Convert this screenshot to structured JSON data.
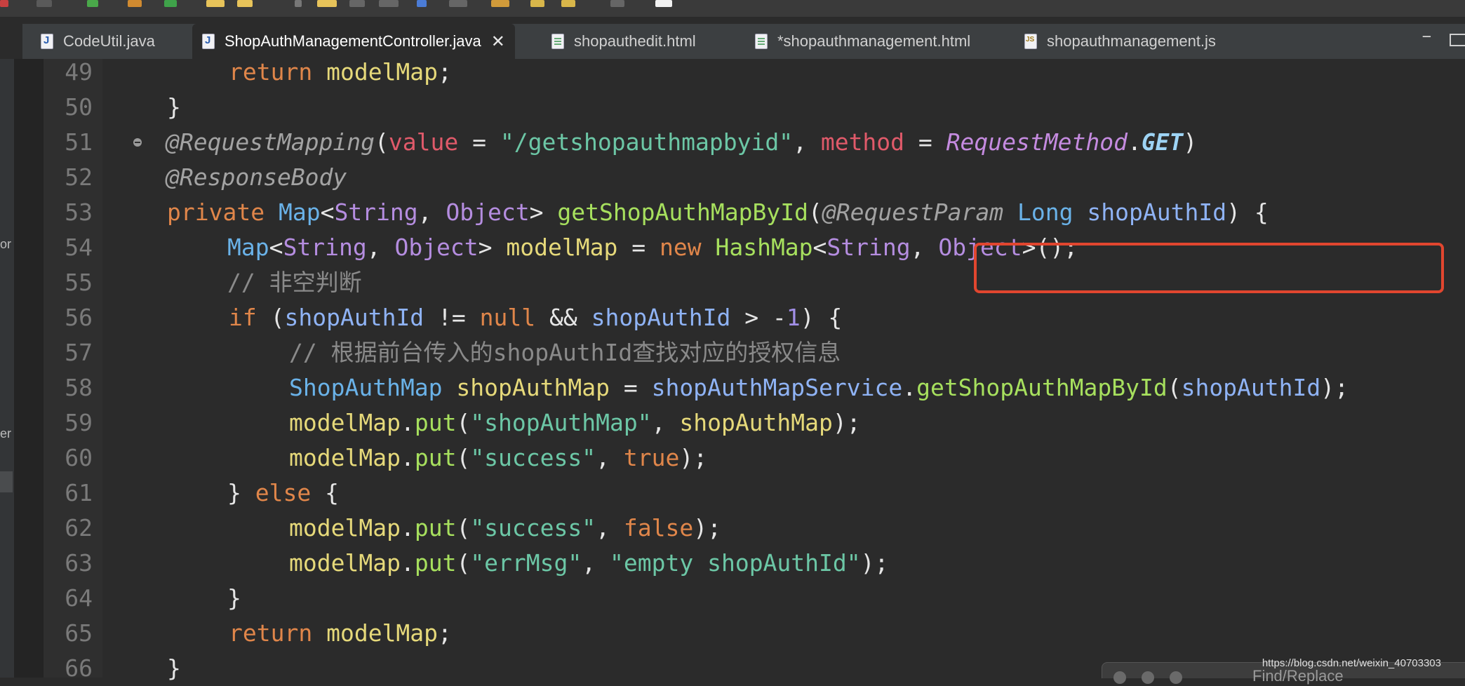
{
  "tabs": [
    {
      "label": "CodeUtil.java",
      "icon": "java-file-icon",
      "active": false
    },
    {
      "label": "ShopAuthManagementController.java",
      "icon": "java-file-icon",
      "active": true
    },
    {
      "label": "shopauthedit.html",
      "icon": "html-file-icon",
      "active": false
    },
    {
      "label": "*shopauthmanagement.html",
      "icon": "html-file-icon",
      "active": false
    },
    {
      "label": "shopauthmanagement.js",
      "icon": "js-file-icon",
      "active": false
    }
  ],
  "close_glyph": "✕",
  "window_controls": {
    "minimize": "−"
  },
  "left_panel": {
    "fragment_1": "or",
    "fragment_2": "er"
  },
  "line_numbers": [
    "49",
    "50",
    "51",
    "52",
    "53",
    "54",
    "55",
    "56",
    "57",
    "58",
    "59",
    "60",
    "61",
    "62",
    "63",
    "64",
    "65",
    "66"
  ],
  "code": {
    "l49_kw": "return",
    "l49_var": "modelMap",
    "l49_end": ";",
    "l50": "}",
    "l51_ann": "@RequestMapping",
    "l51_p1": "(",
    "l51_key1": "value",
    "l51_eq1": " = ",
    "l51_str": "\"/getshopauthmapbyid\"",
    "l51_c": ", ",
    "l51_key2": "method",
    "l51_eq2": " = ",
    "l51_enum": "RequestMethod",
    "l51_dot": ".",
    "l51_get": "GET",
    "l51_p2": ")",
    "l52_ann": "@ResponseBody",
    "l53_kw": "private",
    "l53_ty": "Map",
    "l53_lt": "<",
    "l53_g1": "String",
    "l53_cm": ", ",
    "l53_g2": "Object",
    "l53_gt": "> ",
    "l53_fn": "getShopAuthMapById",
    "l53_p1": "(",
    "l53_ann": "@RequestParam",
    "l53_ty2": "Long",
    "l53_var": "shopAuthId",
    "l53_p2": ")",
    "l53_brace": " {",
    "l54_ty": "Map",
    "l54_lt": "<",
    "l54_g1": "String",
    "l54_cm": ", ",
    "l54_g2": "Object",
    "l54_gt": "> ",
    "l54_var": "modelMap",
    "l54_eq": " = ",
    "l54_new": "new",
    "l54_ty2": "HashMap",
    "l54_lt2": "<",
    "l54_g3": "String",
    "l54_cm2": ", ",
    "l54_g4": "Object",
    "l54_end": ">();",
    "l55_cmt": "// 非空判断",
    "l56_kw": "if",
    "l56_p": " (",
    "l56_var1": "shopAuthId",
    "l56_op1": " != ",
    "l56_null": "null",
    "l56_op2": " && ",
    "l56_var2": "shopAuthId",
    "l56_op3": " > -",
    "l56_num": "1",
    "l56_end": ") {",
    "l57_cmt": "// 根据前台传入的shopAuthId查找对应的授权信息",
    "l58_ty": "ShopAuthMap",
    "l58_var": "shopAuthMap",
    "l58_eq": " = ",
    "l58_svc": "shopAuthMapService",
    "l58_dot": ".",
    "l58_m": "getShopAuthMapById",
    "l58_p1": "(",
    "l58_arg": "shopAuthId",
    "l58_end": ");",
    "l59_obj": "modelMap",
    "l59_dot": ".",
    "l59_m": "put",
    "l59_p": "(",
    "l59_str": "\"shopAuthMap\"",
    "l59_cm": ", ",
    "l59_arg": "shopAuthMap",
    "l59_end": ");",
    "l60_obj": "modelMap",
    "l60_dot": ".",
    "l60_m": "put",
    "l60_p": "(",
    "l60_str": "\"success\"",
    "l60_cm": ", ",
    "l60_val": "true",
    "l60_end": ");",
    "l61_b": "} ",
    "l61_kw": "else",
    "l61_end": " {",
    "l62_obj": "modelMap",
    "l62_dot": ".",
    "l62_m": "put",
    "l62_p": "(",
    "l62_str": "\"success\"",
    "l62_cm": ", ",
    "l62_val": "false",
    "l62_end": ");",
    "l63_obj": "modelMap",
    "l63_dot": ".",
    "l63_m": "put",
    "l63_p": "(",
    "l63_str1": "\"errMsg\"",
    "l63_cm": ", ",
    "l63_str2": "\"empty shopAuthId\"",
    "l63_end": ");",
    "l64": "}",
    "l65_kw": "return",
    "l65_var": "modelMap",
    "l65_end": ";",
    "l66": "}"
  },
  "highlight": {
    "color": "#e1462f",
    "target": "@RequestParam Long shopAuthId"
  },
  "find_panel": {
    "title": "Find/Replace"
  },
  "watermark": "https://blog.csdn.net/weixin_40703303",
  "colors": {
    "background": "#2b2b2b",
    "keyword": "#e0864a",
    "string": "#6cc7a6",
    "type": "#6ab2e8"
  }
}
